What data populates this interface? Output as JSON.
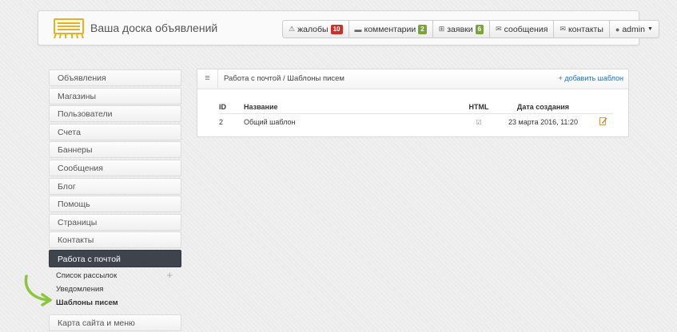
{
  "header": {
    "site_title": "Ваша доска объявлений",
    "logo_icon": "billboard-icon",
    "nav": [
      {
        "label": "жалобы",
        "icon": "warning-icon",
        "badge": "10",
        "badge_color": "#c9302c"
      },
      {
        "label": "комментарии",
        "icon": "comment-icon",
        "badge": "2",
        "badge_color": "#7aa33a"
      },
      {
        "label": "заявки",
        "icon": "cart-icon",
        "badge": "6",
        "badge_color": "#7aa33a"
      },
      {
        "label": "сообщения",
        "icon": "mail-icon"
      },
      {
        "label": "контакты",
        "icon": "mail-icon"
      },
      {
        "label": "admin",
        "icon": "user-icon"
      }
    ]
  },
  "sidebar": {
    "items": [
      {
        "label": "Объявления"
      },
      {
        "label": "Магазины"
      },
      {
        "label": "Пользователи"
      },
      {
        "label": "Счета"
      },
      {
        "label": "Баннеры"
      },
      {
        "label": "Сообщения"
      },
      {
        "label": "Блог"
      },
      {
        "label": "Помощь"
      },
      {
        "label": "Страницы"
      },
      {
        "label": "Контакты"
      }
    ],
    "active": {
      "label": "Работа с почтой"
    },
    "subitems": [
      {
        "label": "Список рассылок"
      },
      {
        "label": "Уведомления"
      },
      {
        "label": "Шаблоны писем"
      }
    ],
    "last": {
      "label": "Карта сайта и меню"
    }
  },
  "panel": {
    "title": "Работа с почтой / Шаблоны писем",
    "add_link": "+ добавить шаблон",
    "columns": {
      "id": "ID",
      "name": "Название",
      "html": "HTML",
      "date": "Дата создания"
    },
    "rows": [
      {
        "id": "2",
        "name": "Общий шаблон",
        "html": true,
        "date": "23 марта 2016, 11:20"
      }
    ]
  },
  "colors": {
    "accent": "#7aa33a",
    "link": "#2a6fb3",
    "logo": "#e6b31e",
    "active_bg": "#3f444c"
  }
}
